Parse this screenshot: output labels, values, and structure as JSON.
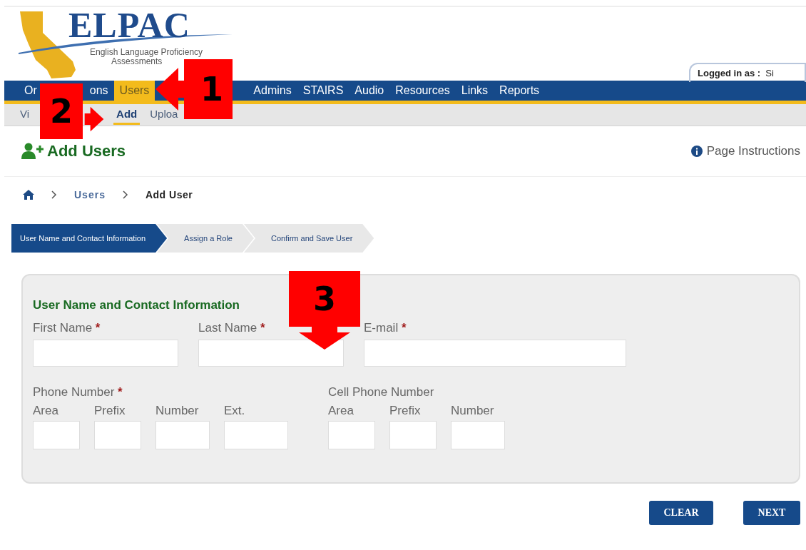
{
  "logo": {
    "name": "ELPAC",
    "tagline_1": "English Language Proficiency",
    "tagline_2": "Assessments"
  },
  "login": {
    "label": "Logged in as :",
    "value": "Si"
  },
  "nav": [
    {
      "parts": [
        "Or",
        "ons"
      ],
      "selected": false
    },
    {
      "parts": [
        "Users"
      ],
      "selected": true
    },
    {
      "parts": [
        "Admins"
      ],
      "selected": false
    },
    {
      "parts": [
        "STAIRS"
      ],
      "selected": false
    },
    {
      "parts": [
        "Audio"
      ],
      "selected": false
    },
    {
      "parts": [
        "Resources"
      ],
      "selected": false
    },
    {
      "parts": [
        "Links"
      ],
      "selected": false
    },
    {
      "parts": [
        "Reports"
      ],
      "selected": false
    }
  ],
  "subnav": [
    {
      "label": "Vi",
      "selected": false
    },
    {
      "label": "Add",
      "selected": true
    },
    {
      "label": "Uploa",
      "selected": false
    }
  ],
  "page_title": "Add Users",
  "page_instructions": "Page Instructions",
  "breadcrumb": [
    {
      "label": "Users",
      "current": false
    },
    {
      "label": "Add User",
      "current": true
    }
  ],
  "steps": [
    {
      "label": "User Name and Contact Information",
      "selected": true
    },
    {
      "label": "Assign a Role",
      "selected": false
    },
    {
      "label": "Confirm and Save User",
      "selected": false
    }
  ],
  "form": {
    "title": "User Name and Contact Information",
    "row1": [
      {
        "label": "First Name",
        "marker": "*"
      },
      {
        "label": "Last Name",
        "marker": "*"
      },
      {
        "label": "E-mail",
        "marker": "*"
      }
    ],
    "phone": {
      "label": "Phone Number",
      "marker": "*",
      "parts": [
        "Area",
        "Prefix",
        "Number",
        "Ext."
      ]
    },
    "cell": {
      "label": "Cell Phone Number",
      "parts": [
        "Area",
        "Prefix",
        "Number"
      ]
    }
  },
  "buttons": [
    "CLEAR",
    "NEXT"
  ],
  "callouts": [
    {
      "label": "1",
      "kind": "left"
    },
    {
      "label": "2",
      "kind": "right"
    },
    {
      "label": "3",
      "kind": "down"
    }
  ]
}
